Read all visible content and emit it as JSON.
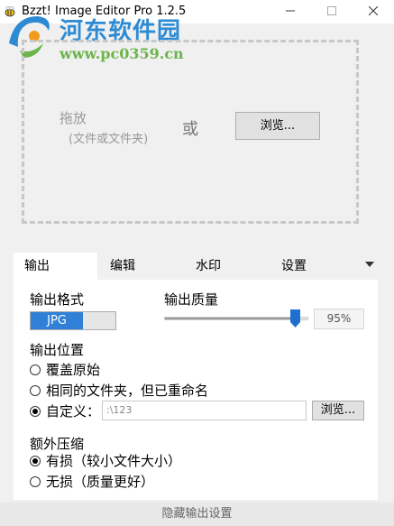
{
  "window": {
    "title": "Bzzt! Image Editor Pro 1.2.5",
    "minimize_icon": "minimize-icon",
    "maximize_icon": "maximize-icon",
    "close_icon": "close-icon"
  },
  "watermark": {
    "line1": "河东软件园",
    "line2": "www.pc0359.cn"
  },
  "dropzone": {
    "drag_label": "拖放",
    "drag_sub": "(文件或文件夹)",
    "or_label": "或",
    "browse_label": "浏览..."
  },
  "tabs": [
    {
      "label": "输出",
      "active": true
    },
    {
      "label": "编辑"
    },
    {
      "label": "水印"
    },
    {
      "label": "设置"
    }
  ],
  "output": {
    "format_label": "输出格式",
    "format_value": "JPG",
    "quality_label": "输出质量",
    "quality_value": "95%",
    "quality_fraction": 0.95,
    "location_label": "输出位置",
    "options": [
      {
        "label": "覆盖原始",
        "checked": false
      },
      {
        "label": "相同的文件夹，但已重命名",
        "checked": false
      },
      {
        "label": "自定义：",
        "checked": true
      }
    ],
    "custom_path": ":\\123",
    "browse_label": "浏览...",
    "compress_label": "额外压缩",
    "compress_options": [
      {
        "label": "有损（较小文件大小）",
        "checked": true
      },
      {
        "label": "无损（质量更好）",
        "checked": false
      }
    ]
  },
  "footer": {
    "label": "隐藏输出设置"
  },
  "colors": {
    "accent": "#2f80d6",
    "watermark_blue": "#2d8bd4",
    "watermark_green": "#6bb44a"
  }
}
